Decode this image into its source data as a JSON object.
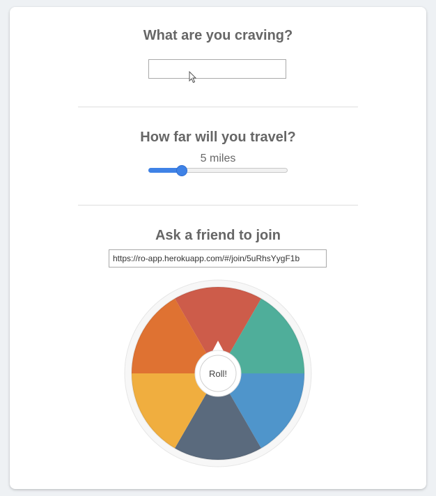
{
  "craving": {
    "heading": "What are you craving?",
    "input_value": "",
    "input_placeholder": ""
  },
  "travel": {
    "heading": "How far will you travel?",
    "distance_label": "5 miles",
    "slider_fraction": 0.2
  },
  "invite": {
    "heading": "Ask a friend to join",
    "share_link": "https://ro-app.herokuapp.com/#/join/5uRhsYygF1b"
  },
  "wheel": {
    "button_label": "Roll!",
    "segment_colors": [
      "#cd5c4a",
      "#4fae9a",
      "#4f95cb",
      "#5a6a7d",
      "#f0ae3f",
      "#df7232"
    ]
  },
  "colors": {
    "accent": "#3f82e6",
    "heading_text": "#666666",
    "background": "#eef1f4"
  }
}
